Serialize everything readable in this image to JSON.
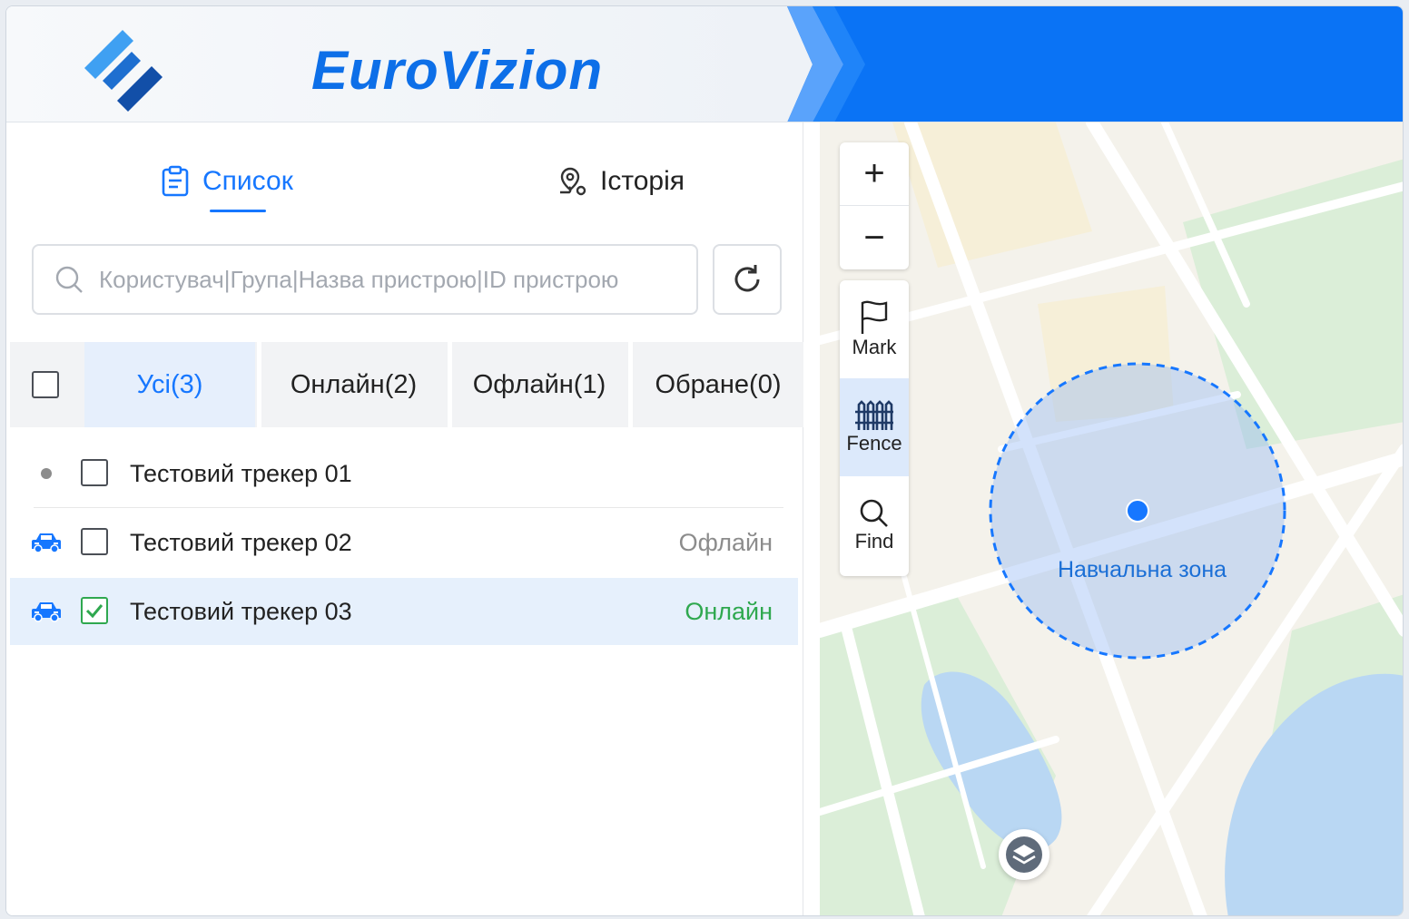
{
  "app": {
    "brand": "EuroVizion",
    "colors": {
      "accent": "#1677ff",
      "header_blue": "#0a73f5",
      "online": "#2fa84f",
      "offline": "#8c8c8c"
    }
  },
  "tabs": [
    {
      "label": "Список",
      "icon": "clipboard-list-icon",
      "active": true
    },
    {
      "label": "Історія",
      "icon": "map-pin-route-icon",
      "active": false
    }
  ],
  "search": {
    "placeholder": "Користувач|Група|Назва пристрою|ID пристрою",
    "value": ""
  },
  "filters": [
    {
      "label": "Усі(3)",
      "active": true
    },
    {
      "label": "Онлайн(2)",
      "active": false
    },
    {
      "label": "Офлайн(1)",
      "active": false
    },
    {
      "label": "Обране(0)",
      "active": false
    }
  ],
  "devices": [
    {
      "name": "Тестовий трекер 01",
      "status": "",
      "icon": "status-dot",
      "checked": false
    },
    {
      "name": "Тестовий трекер 02",
      "status": "Офлайн",
      "icon": "car-icon",
      "checked": false
    },
    {
      "name": "Тестовий трекер 03",
      "status": "Онлайн",
      "icon": "car-icon",
      "checked": true
    }
  ],
  "map": {
    "controls": {
      "zoom_in": "+",
      "zoom_out": "−",
      "mark": "Mark",
      "fence": "Fence",
      "find": "Find"
    },
    "zone_label": "Навчальна зона"
  }
}
